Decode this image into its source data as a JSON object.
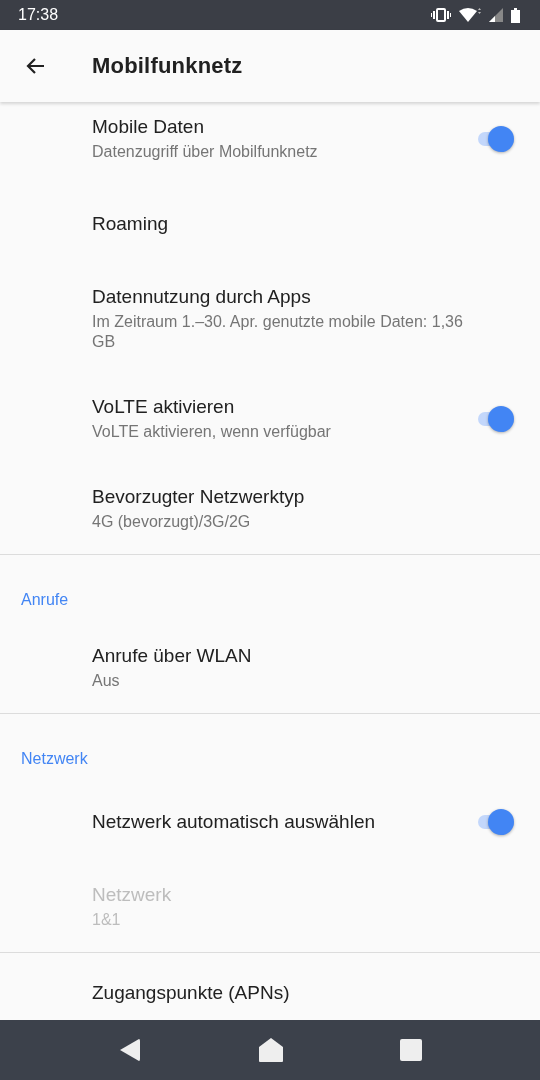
{
  "status_bar": {
    "time": "17:38"
  },
  "app_bar": {
    "title": "Mobilfunknetz"
  },
  "sections": [
    {
      "items": [
        {
          "kind": "switch",
          "title": "Mobile Daten",
          "summary": "Datenzugriff über Mobilfunknetz",
          "on": true,
          "disabled": false
        },
        {
          "kind": "plain",
          "title": "Roaming",
          "disabled": false
        },
        {
          "kind": "plain",
          "title": "Datennutzung durch Apps",
          "summary": "Im Zeitraum 1.–30. Apr. genutzte mobile Daten: 1,36 GB",
          "disabled": false
        },
        {
          "kind": "switch",
          "title": "VoLTE aktivieren",
          "summary": "VoLTE aktivieren, wenn verfügbar",
          "on": true,
          "disabled": false
        },
        {
          "kind": "plain",
          "title": "Bevorzugter Netzwerktyp",
          "summary": "4G (bevorzugt)/3G/2G",
          "disabled": false
        }
      ]
    },
    {
      "header": "Anrufe",
      "items": [
        {
          "kind": "plain",
          "title": "Anrufe über WLAN",
          "summary": "Aus",
          "disabled": false
        }
      ]
    },
    {
      "header": "Netzwerk",
      "items": [
        {
          "kind": "switch",
          "title": "Netzwerk automatisch auswählen",
          "on": true,
          "disabled": false
        },
        {
          "kind": "plain",
          "title": "Netzwerk",
          "summary": "1&1",
          "disabled": true
        }
      ]
    },
    {
      "items": [
        {
          "kind": "plain",
          "title": "Zugangspunkte (APNs)",
          "disabled": false
        }
      ]
    }
  ]
}
